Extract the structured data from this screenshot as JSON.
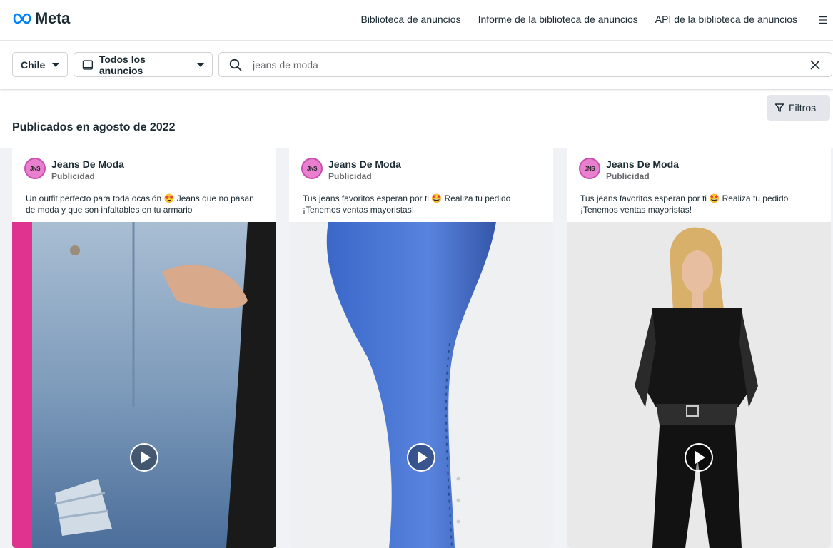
{
  "header": {
    "logo_text": "Meta",
    "nav": [
      "Biblioteca de anuncios",
      "Informe de la biblioteca de anuncios",
      "API de la biblioteca de anuncios"
    ],
    "menu_icon": "hamburger-menu-icon"
  },
  "filters": {
    "country": "Chile",
    "ad_type": "Todos los anuncios",
    "search_value": "jeans de moda",
    "filter_button": "Filtros"
  },
  "section": {
    "title": "Publicados en agosto de 2022"
  },
  "cards": [
    {
      "page_name": "Jeans De Moda",
      "label": "Publicidad",
      "avatar_text": "JNS",
      "text": "Un outfit perfecto para toda ocasión 😍 Jeans que no pasan de moda y que son infaltables en tu armario"
    },
    {
      "page_name": "Jeans De Moda",
      "label": "Publicidad",
      "avatar_text": "JNS",
      "text": "Tus jeans favoritos esperan por ti 🤩 Realiza tu pedido ¡Tenemos ventas mayoristas!"
    },
    {
      "page_name": "Jeans De Moda",
      "label": "Publicidad",
      "avatar_text": "JNS",
      "text": "Tus jeans favoritos esperan por ti 🤩 Realiza tu pedido ¡Tenemos ventas mayoristas!"
    }
  ],
  "colors": {
    "brand_blue": "#0081fb",
    "text_primary": "#1c2b33",
    "text_secondary": "#65676b",
    "background": "#f0f2f5"
  }
}
